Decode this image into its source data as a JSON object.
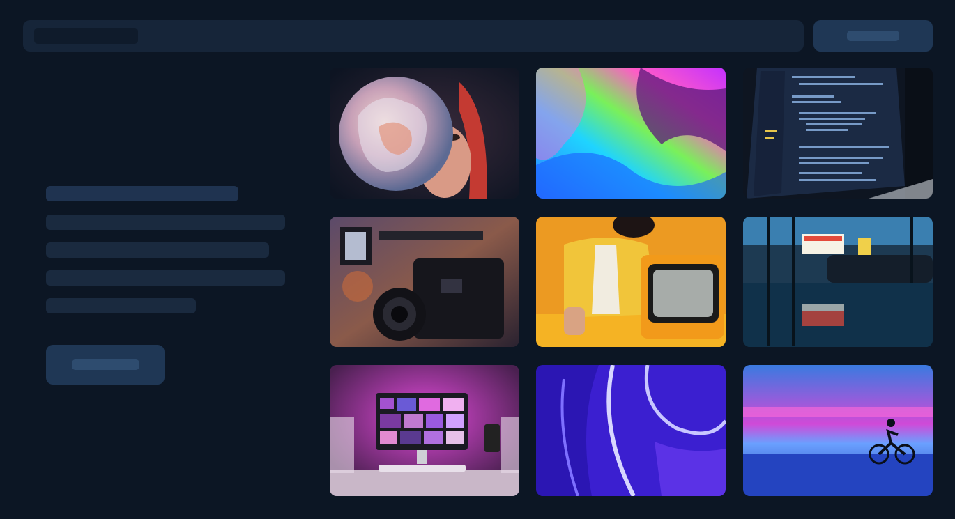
{
  "header": {
    "search": {
      "placeholder": "",
      "icon": "search-icon"
    },
    "action_button": {
      "label": ""
    }
  },
  "hero": {
    "text_lines": [
      "",
      "",
      "",
      "",
      ""
    ],
    "cta_button": {
      "label": ""
    }
  },
  "gallery": {
    "images": [
      {
        "name": "portrait-flower"
      },
      {
        "name": "fluid-rainbow"
      },
      {
        "name": "code-laptop"
      },
      {
        "name": "cinema-camera"
      },
      {
        "name": "retro-tv"
      },
      {
        "name": "tower-theater"
      },
      {
        "name": "desk-setup"
      },
      {
        "name": "purple-liquid"
      },
      {
        "name": "cyclist-neon"
      }
    ]
  },
  "colors": {
    "background": "#0c1624",
    "surface": "#162539",
    "button": "#1f3755",
    "skeleton": "#1a2a3f"
  }
}
